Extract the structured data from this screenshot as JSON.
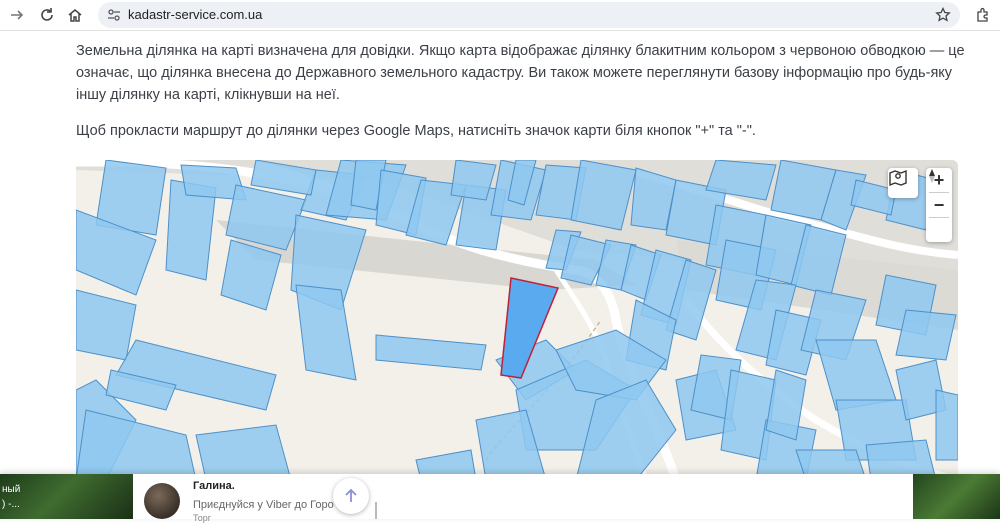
{
  "browser": {
    "url": "kadastr-service.com.ua"
  },
  "content": {
    "paragraph1": "Земельна ділянка на карті визначена для довідки. Якщо карта відображає ділянку блакитним кольором з червоною обводкою — це означає, що ділянка внесена до Державного земельного кадастру. Ви також можете переглянути базову інформацію про будь-яку іншу ділянку на карті, клікнувши на неї.",
    "paragraph2": "Щоб прокласти маршрут до ділянки через Google Maps, натисніть значок карти біля кнопок \"+\" та \"-\"."
  },
  "map": {
    "zoom_in_label": "+",
    "zoom_out_label": "−",
    "parcel_fill": "#8ec8f0",
    "parcel_stroke": "#4d90c9",
    "selected_fill": "#5aaaf0",
    "selected_stroke": "#c0213a"
  },
  "ad": {
    "left_text_line1": "ный",
    "left_text_line2": ") -...",
    "sender_name": "Галина.",
    "message": "Приєднуйся у Viber до Горо",
    "message2": "Торг"
  }
}
